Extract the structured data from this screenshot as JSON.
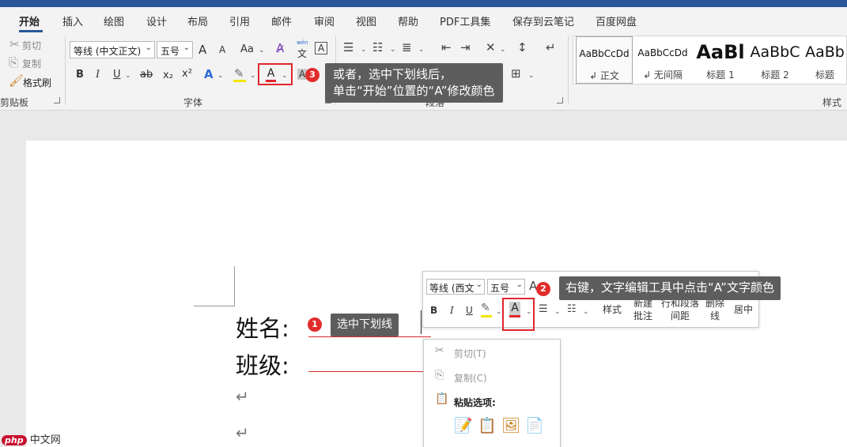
{
  "tabs": [
    "开始",
    "插入",
    "绘图",
    "设计",
    "布局",
    "引用",
    "邮件",
    "审阅",
    "视图",
    "帮助",
    "PDF工具集",
    "保存到云笔记",
    "百度网盘"
  ],
  "clipboard": {
    "cut": "剪切",
    "copy": "复制",
    "format_painter": "格式刷",
    "group_label": "剪贴板"
  },
  "font": {
    "font_name": "等线 (中文正文)",
    "font_size": "五号",
    "grow": "A",
    "shrink": "A",
    "change_case": "Aa",
    "bold": "B",
    "italic": "I",
    "underline": "U",
    "strike": "ab",
    "subscript": "x₂",
    "superscript": "x²",
    "font_color_letter": "A",
    "char_shading": "A",
    "phonetic_top": "wén",
    "phonetic_bottom": "文",
    "border_char": "A",
    "group_label": "字体"
  },
  "paragraph": {
    "group_label": "段落"
  },
  "styles": {
    "items": [
      {
        "sample": "AaBbCcDd",
        "name": "↲ 正文"
      },
      {
        "sample": "AaBbCcDd",
        "name": "↲ 无间隔"
      },
      {
        "sample": "AaBl",
        "name": "标题 1"
      },
      {
        "sample": "AaBbC",
        "name": "标题 2"
      },
      {
        "sample": "AaBb",
        "name": "标题"
      }
    ],
    "group_label": "样式"
  },
  "tooltips": {
    "t1": "选中下划线",
    "t2": "右键，文字编辑工具中点击“A”文字颜色",
    "t3_line1": "或者，选中下划线后，",
    "t3_line2": "单击“开始”位置的“A”修改颜色"
  },
  "badges": {
    "b1": "1",
    "b2": "2",
    "b3": "3"
  },
  "document": {
    "line1": "姓名:",
    "line2": "班级:",
    "paragraph_mark": "↵"
  },
  "mini_toolbar": {
    "font_name": "等线 (西文",
    "font_size": "五号",
    "bold": "B",
    "italic": "I",
    "underline": "U",
    "font_color_letter": "A",
    "styles": "样式",
    "new_comment": "新建批注",
    "line_spacing": "行和段落间距",
    "delete_line": "删除线",
    "center": "居中"
  },
  "context_menu": {
    "cut": "剪切(T)",
    "copy": "复制(C)",
    "paste_options": "粘贴选项:"
  },
  "watermark": {
    "brand": "php",
    "site": "中文网"
  },
  "colors": {
    "accent": "#2b579a",
    "highlight_red": "#e0262b",
    "tooltip_bg": "#5d5d5d"
  }
}
